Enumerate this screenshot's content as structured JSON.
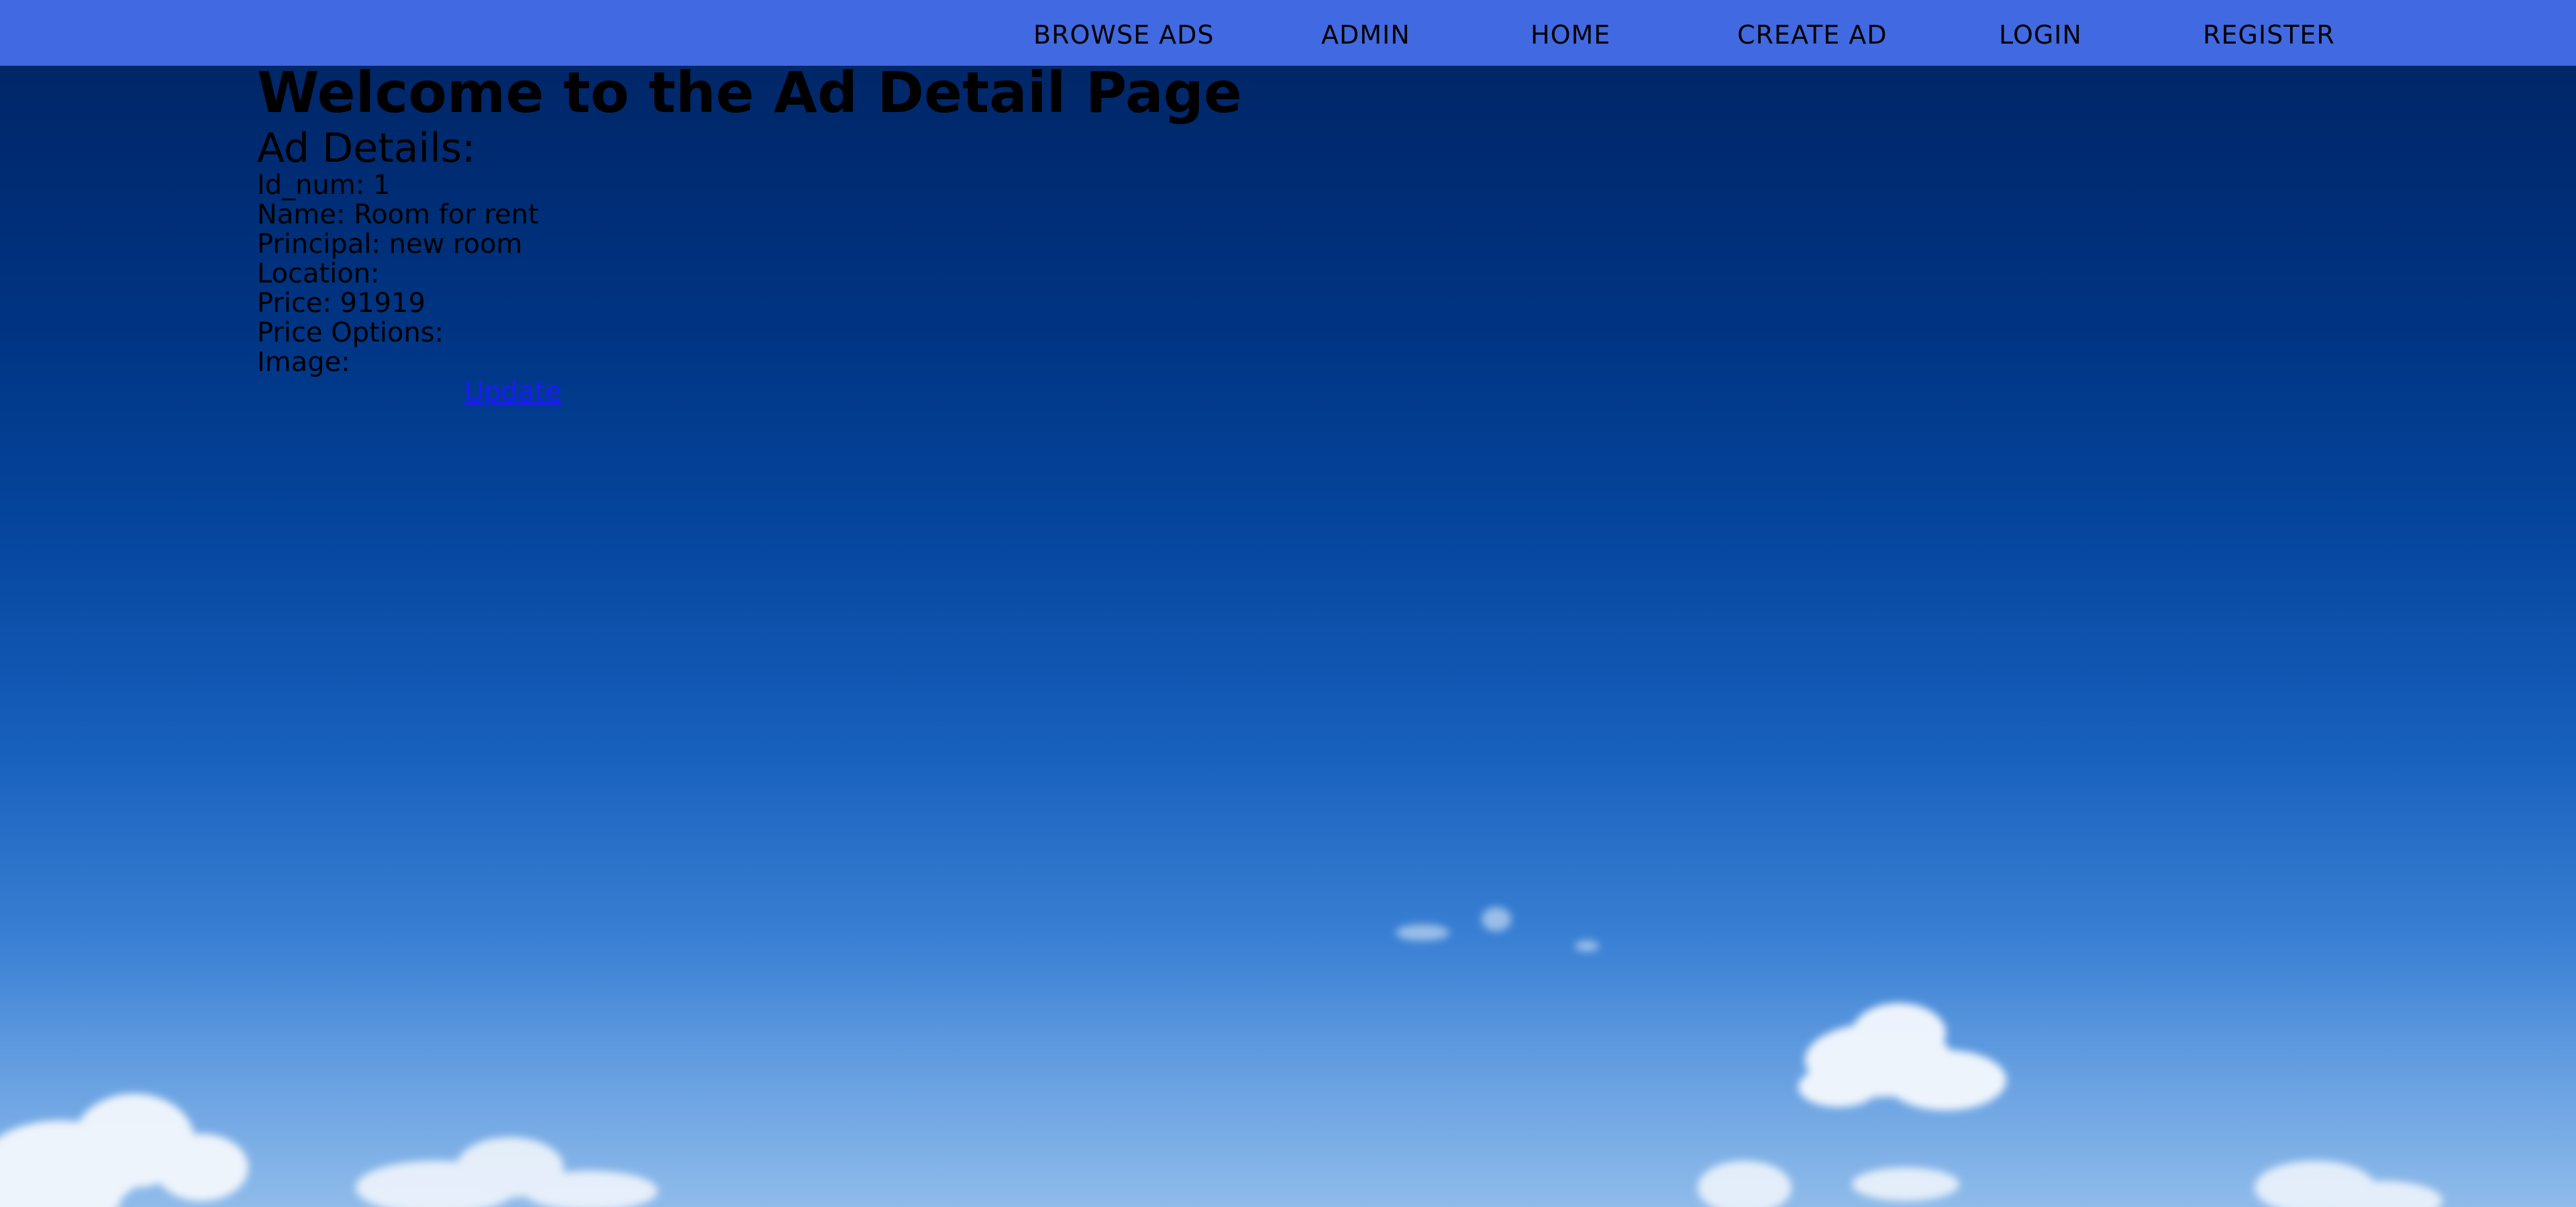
{
  "nav": {
    "items": [
      {
        "label": "BROWSE ADS"
      },
      {
        "label": "ADMIN"
      },
      {
        "label": "HOME"
      },
      {
        "label": "CREATE AD"
      },
      {
        "label": "LOGIN"
      },
      {
        "label": "REGISTER"
      }
    ],
    "bar_color": "#4169e1"
  },
  "page": {
    "title": "Welcome to the Ad Detail Page",
    "section_title": "Ad Details:"
  },
  "ad": {
    "id_line": "Id_num: 1",
    "name_line": "Name: Room for rent",
    "principal_line": "Principal: new room",
    "location_line": "Location:",
    "price_line": "Price: 91919",
    "price_options_line": "Price Options:",
    "image_line": "Image:"
  },
  "actions": {
    "update_label": "Update",
    "link_color": "#1a1aff"
  },
  "background": {
    "description_icon": "sky-clouds-background"
  }
}
